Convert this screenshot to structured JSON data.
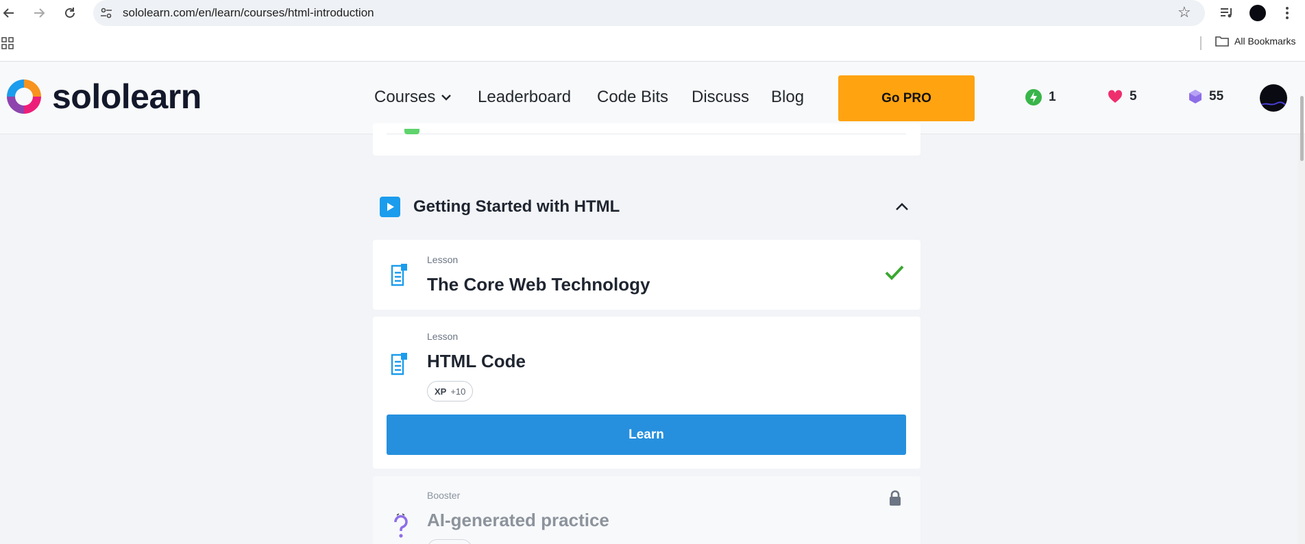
{
  "browser": {
    "url": "sololearn.com/en/learn/courses/html-introduction",
    "bookmarks_label": "All Bookmarks"
  },
  "header": {
    "brand": "sololearn",
    "nav": {
      "courses": "Courses",
      "leaderboard": "Leaderboard",
      "code_bits": "Code Bits",
      "discuss": "Discuss",
      "blog": "Blog"
    },
    "go_pro": "Go PRO",
    "stats": {
      "streak": "1",
      "hearts": "5",
      "gems": "55"
    },
    "colors": {
      "accent_orange": "#ffa311",
      "streak_green": "#39b54a",
      "heart_pink": "#ef2e6e",
      "gem_purple": "#8e6ee8"
    }
  },
  "module": {
    "title": "Getting Started with HTML",
    "lessons": [
      {
        "type": "Lesson",
        "title": "The Core Web Technology",
        "completed": true
      },
      {
        "type": "Lesson",
        "title": "HTML Code",
        "xp_label": "XP",
        "xp_value": "+10",
        "action": "Learn"
      },
      {
        "type": "Booster",
        "title": "AI-generated practice",
        "locked": true
      }
    ],
    "colors": {
      "primary_blue": "#2690de",
      "check_green": "#3aa82f"
    }
  }
}
